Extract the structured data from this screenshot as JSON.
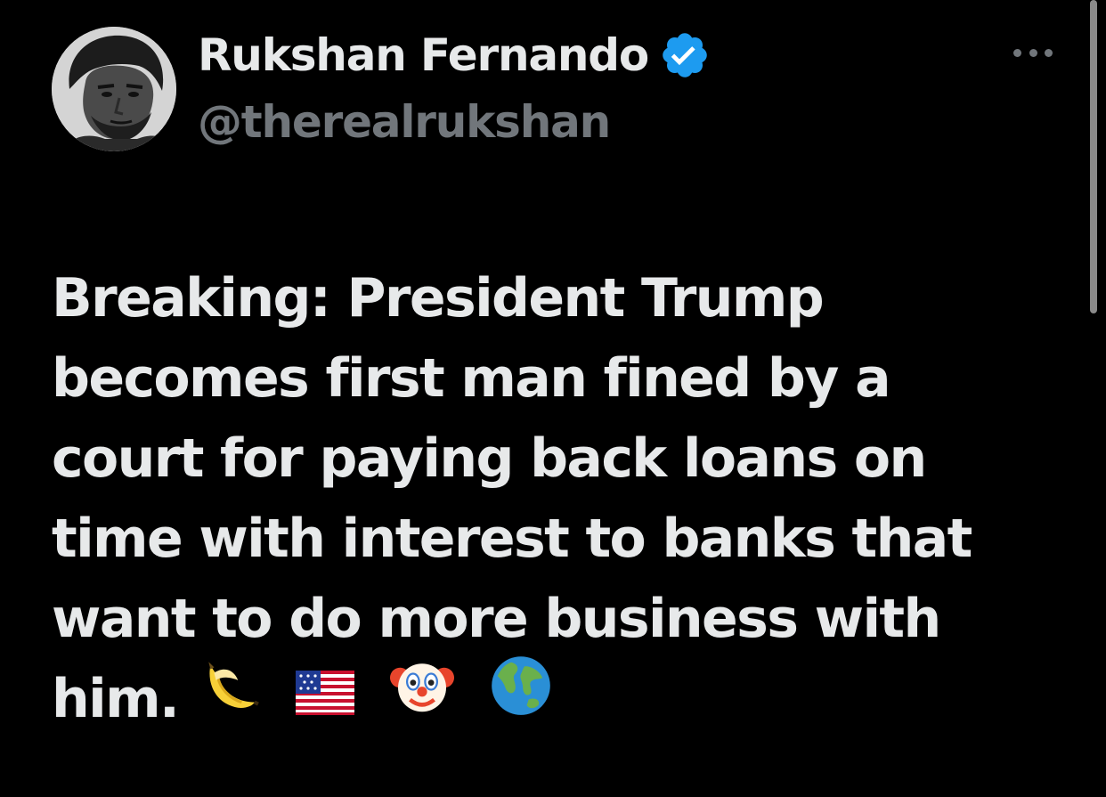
{
  "tweet": {
    "author": {
      "display_name": "Rukshan Fernando",
      "handle": "@therealrukshan",
      "verified": true,
      "verified_color": "#1d9bf0"
    },
    "text_lines": [
      "Breaking: President Trump",
      "becomes first man fined by a",
      "court for paying back loans on",
      "time with interest to banks that",
      "want to do more business with",
      "him."
    ],
    "emojis": [
      "banana-emoji",
      "us-flag-emoji",
      "clown-face-emoji",
      "globe-emoji"
    ]
  },
  "colors": {
    "background": "#000000",
    "text_primary": "#e7e9ea",
    "text_secondary": "#71767b"
  }
}
